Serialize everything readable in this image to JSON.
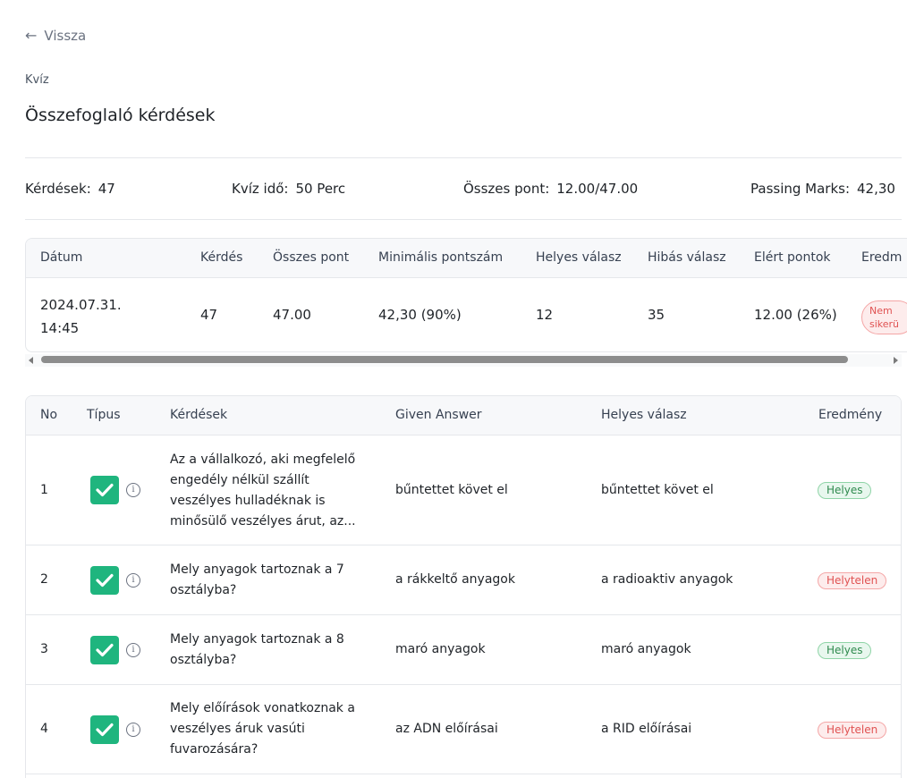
{
  "nav": {
    "back_label": "Vissza"
  },
  "header": {
    "kicker": "Kvíz",
    "title": "Összefoglaló kérdések"
  },
  "stats": {
    "questions_label": "Kérdések:",
    "questions_value": "47",
    "time_label": "Kvíz idő:",
    "time_value": "50 Perc",
    "total_label": "Összes pont:",
    "total_value": "12.00/47.00",
    "passing_label": "Passing Marks:",
    "passing_value": "42,30"
  },
  "summary": {
    "headers": [
      "Dátum",
      "Kérdés",
      "Összes pont",
      "Minimális pontszám",
      "Helyes válasz",
      "Hibás válasz",
      "Elért pontok",
      "Eredm"
    ],
    "row": {
      "date": "2024.07.31. 14:45",
      "questions": "47",
      "total": "47.00",
      "min_score": "42,30 (90%)",
      "correct": "12",
      "wrong": "35",
      "earned": "12.00 (26%)",
      "result": "Nem sikerü"
    }
  },
  "questions": {
    "headers": [
      "No",
      "Típus",
      "Kérdések",
      "Given Answer",
      "Helyes válasz",
      "Eredmény"
    ],
    "rows": [
      {
        "no": "1",
        "question": "Az a vállalkozó, aki megfelelő engedély nélkül szállít veszélyes hulladéknak is minősülő veszélyes árut, az...",
        "given": "bűntettet követ el",
        "correct": "bűntettet követ el",
        "result": "Helyes",
        "result_color": "#2f8a4e"
      },
      {
        "no": "2",
        "question": "Mely anyagok tartoznak a 7 osztályba?",
        "given": "a rákkeltő anyagok",
        "correct": "a radioaktiv anyagok",
        "result": "Helytelen",
        "result_color": "#e05252"
      },
      {
        "no": "3",
        "question": "Mely anyagok tartoznak a 8 osztályba?",
        "given": "maró anyagok",
        "correct": "maró anyagok",
        "result": "Helyes",
        "result_color": "#2f8a4e"
      },
      {
        "no": "4",
        "question": "Mely előírások vonatkoznak a veszélyes áruk vasúti fuvarozására?",
        "given": "az ADN előírásai",
        "correct": "a RID előírásai",
        "result": "Helytelen",
        "result_color": "#e05252"
      }
    ]
  },
  "icons": {
    "back": "arrow-left-icon",
    "type": "checkbox-checked-icon",
    "info": "info-circle-icon"
  }
}
